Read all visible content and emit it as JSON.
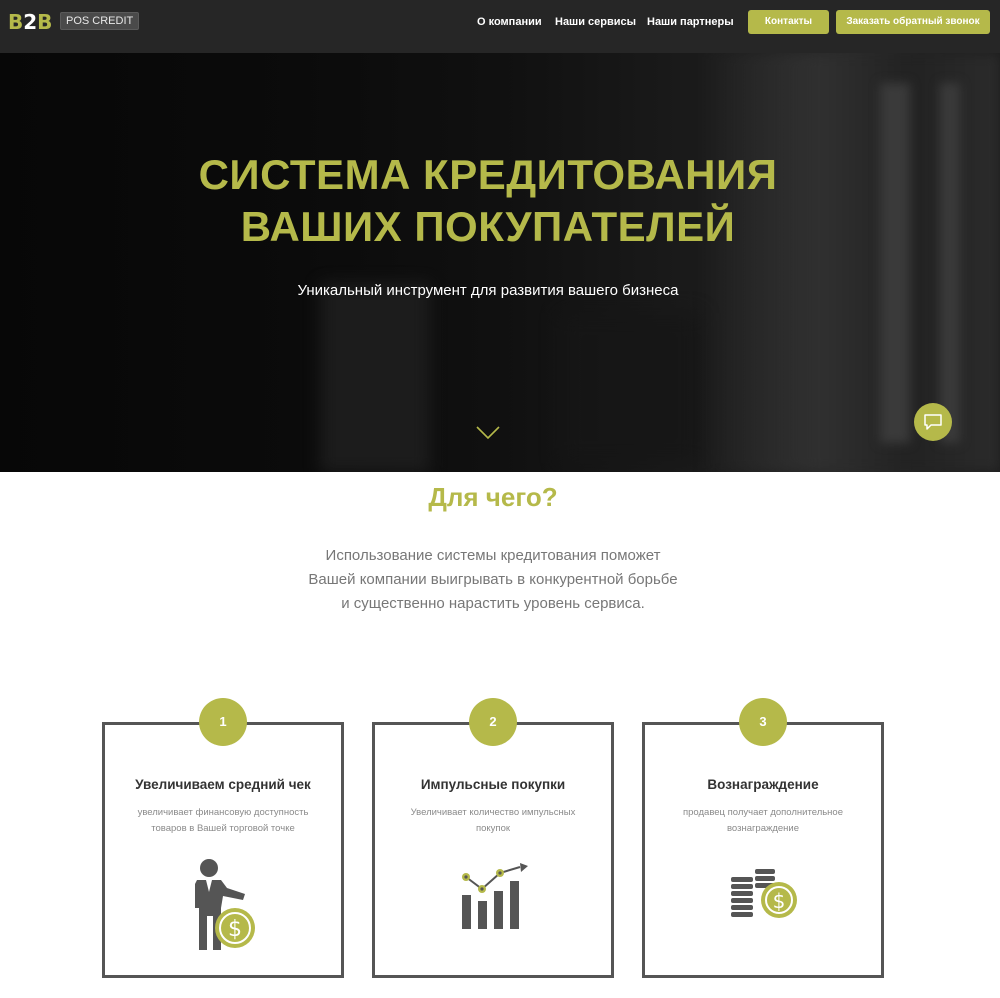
{
  "header": {
    "logo_b": "B",
    "logo_2": "2",
    "logo_b2": "B",
    "badge": "POS CREDIT",
    "nav": [
      {
        "label": "О компании"
      },
      {
        "label": "Наши сервисы"
      },
      {
        "label": "Наши партнеры"
      }
    ],
    "contacts_label": "Контакты",
    "callback_label": "Заказать обратный звонок"
  },
  "hero": {
    "title_line1": "СИСТЕМА КРЕДИТОВАНИЯ",
    "title_line2": "ВАШИХ ПОКУПАТЕЛЕЙ",
    "subtitle": "Уникальный инструмент для развития вашего бизнеса"
  },
  "section": {
    "title": "Для чего?",
    "text": "Использование системы кредитования поможет Вашей компании выигрывать в конкурентной борьбе и существенно нарастить уровень сервиса."
  },
  "cards": [
    {
      "number": "1",
      "title": "Увеличиваем средний чек",
      "desc": "увеличивает финансовую доступность товаров в Вашей торговой точке",
      "icon": "businessman-dollar-icon"
    },
    {
      "number": "2",
      "title": "Импульсные покупки",
      "desc": "Увеличивает количество импульсных покупок",
      "icon": "growth-chart-icon"
    },
    {
      "number": "3",
      "title": "Вознаграждение",
      "desc": "продавец получает дополнительное вознаграждение",
      "icon": "coins-dollar-icon"
    }
  ],
  "colors": {
    "accent": "#b5b94a",
    "header_bg": "#262626",
    "card_border": "#555555",
    "icon_dark": "#555555"
  }
}
